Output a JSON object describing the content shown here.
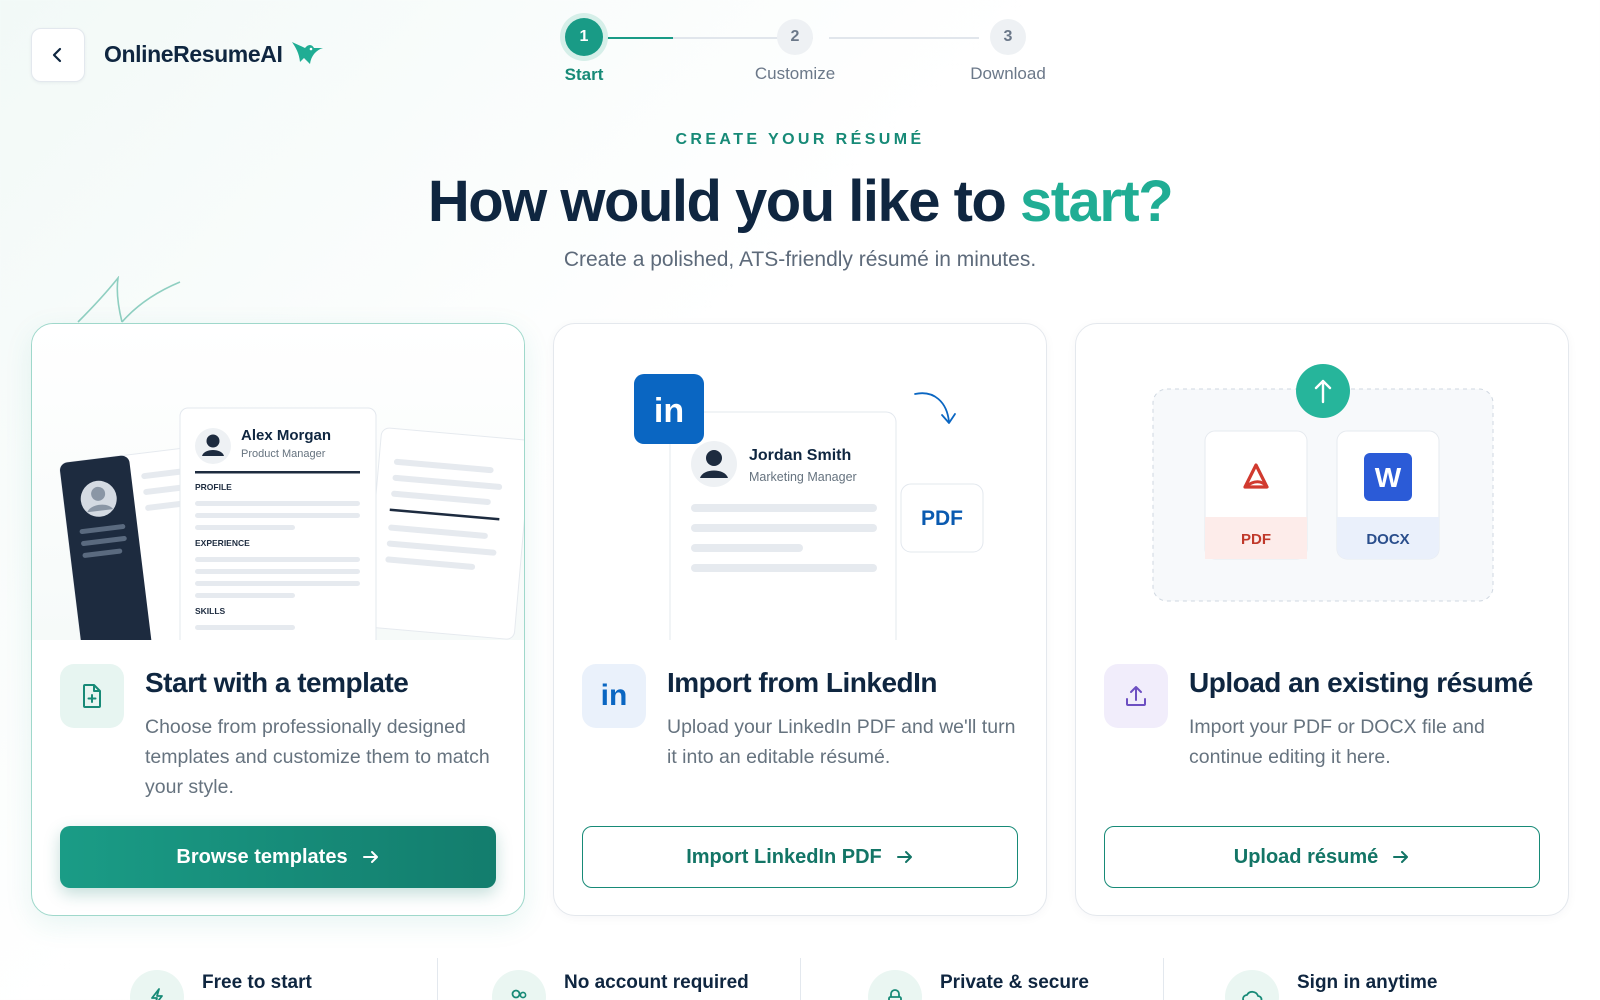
{
  "header": {
    "back_label": "",
    "brand": "OnlineResumeAI"
  },
  "stepper": {
    "current_step": 1,
    "steps": [
      {
        "number": "1",
        "label": "Start"
      },
      {
        "number": "2",
        "label": "Customize"
      },
      {
        "number": "3",
        "label": "Download"
      }
    ]
  },
  "hero": {
    "eyebrow": "CREATE YOUR RÉSUMÉ",
    "headline_main": "How would you like to ",
    "headline_accent": "start?",
    "subhead": "Create a polished, ATS-friendly résumé in minutes."
  },
  "cards": {
    "template": {
      "title": "Start with a template",
      "description": "Choose from professionally designed templates and customize them to match your style.",
      "button": "Browse templates",
      "icon": "file-plus-icon",
      "preview": {
        "name": "Alex Morgan",
        "role": "Product Manager",
        "section_profile": "PROFILE",
        "section_experience": "EXPERIENCE",
        "section_skills": "SKILLS"
      }
    },
    "linkedin": {
      "title": "Import from LinkedIn",
      "description": "Upload your LinkedIn PDF and we'll turn it into an editable résumé.",
      "button": "Import LinkedIn PDF",
      "icon": "linkedin-icon",
      "badge": "in",
      "preview": {
        "name": "Jordan Smith",
        "role": "Marketing Manager",
        "pdf_tag": "PDF"
      }
    },
    "upload": {
      "title": "Upload an existing résumé",
      "description": "Import your PDF or DOCX file and continue editing it here.",
      "button": "Upload résumé",
      "icon": "upload-icon",
      "files": [
        {
          "label": "PDF",
          "icon": "acrobat-icon"
        },
        {
          "label": "DOCX",
          "icon": "word-icon",
          "glyph": "W"
        }
      ]
    }
  },
  "features": [
    {
      "label": "Free to start",
      "icon": "bolt-icon"
    },
    {
      "label": "No account required",
      "icon": "users-icon"
    },
    {
      "label": "Private & secure",
      "icon": "lock-icon"
    },
    {
      "label": "Sign in anytime",
      "icon": "cloud-icon"
    }
  ],
  "colors": {
    "brand_teal": "#199b86",
    "accent_teal": "#20ad94",
    "navy": "#0f2640",
    "linkedin_blue": "#0a66c2",
    "word_blue": "#2b5bd7",
    "pdf_red": "#d13a2f"
  }
}
